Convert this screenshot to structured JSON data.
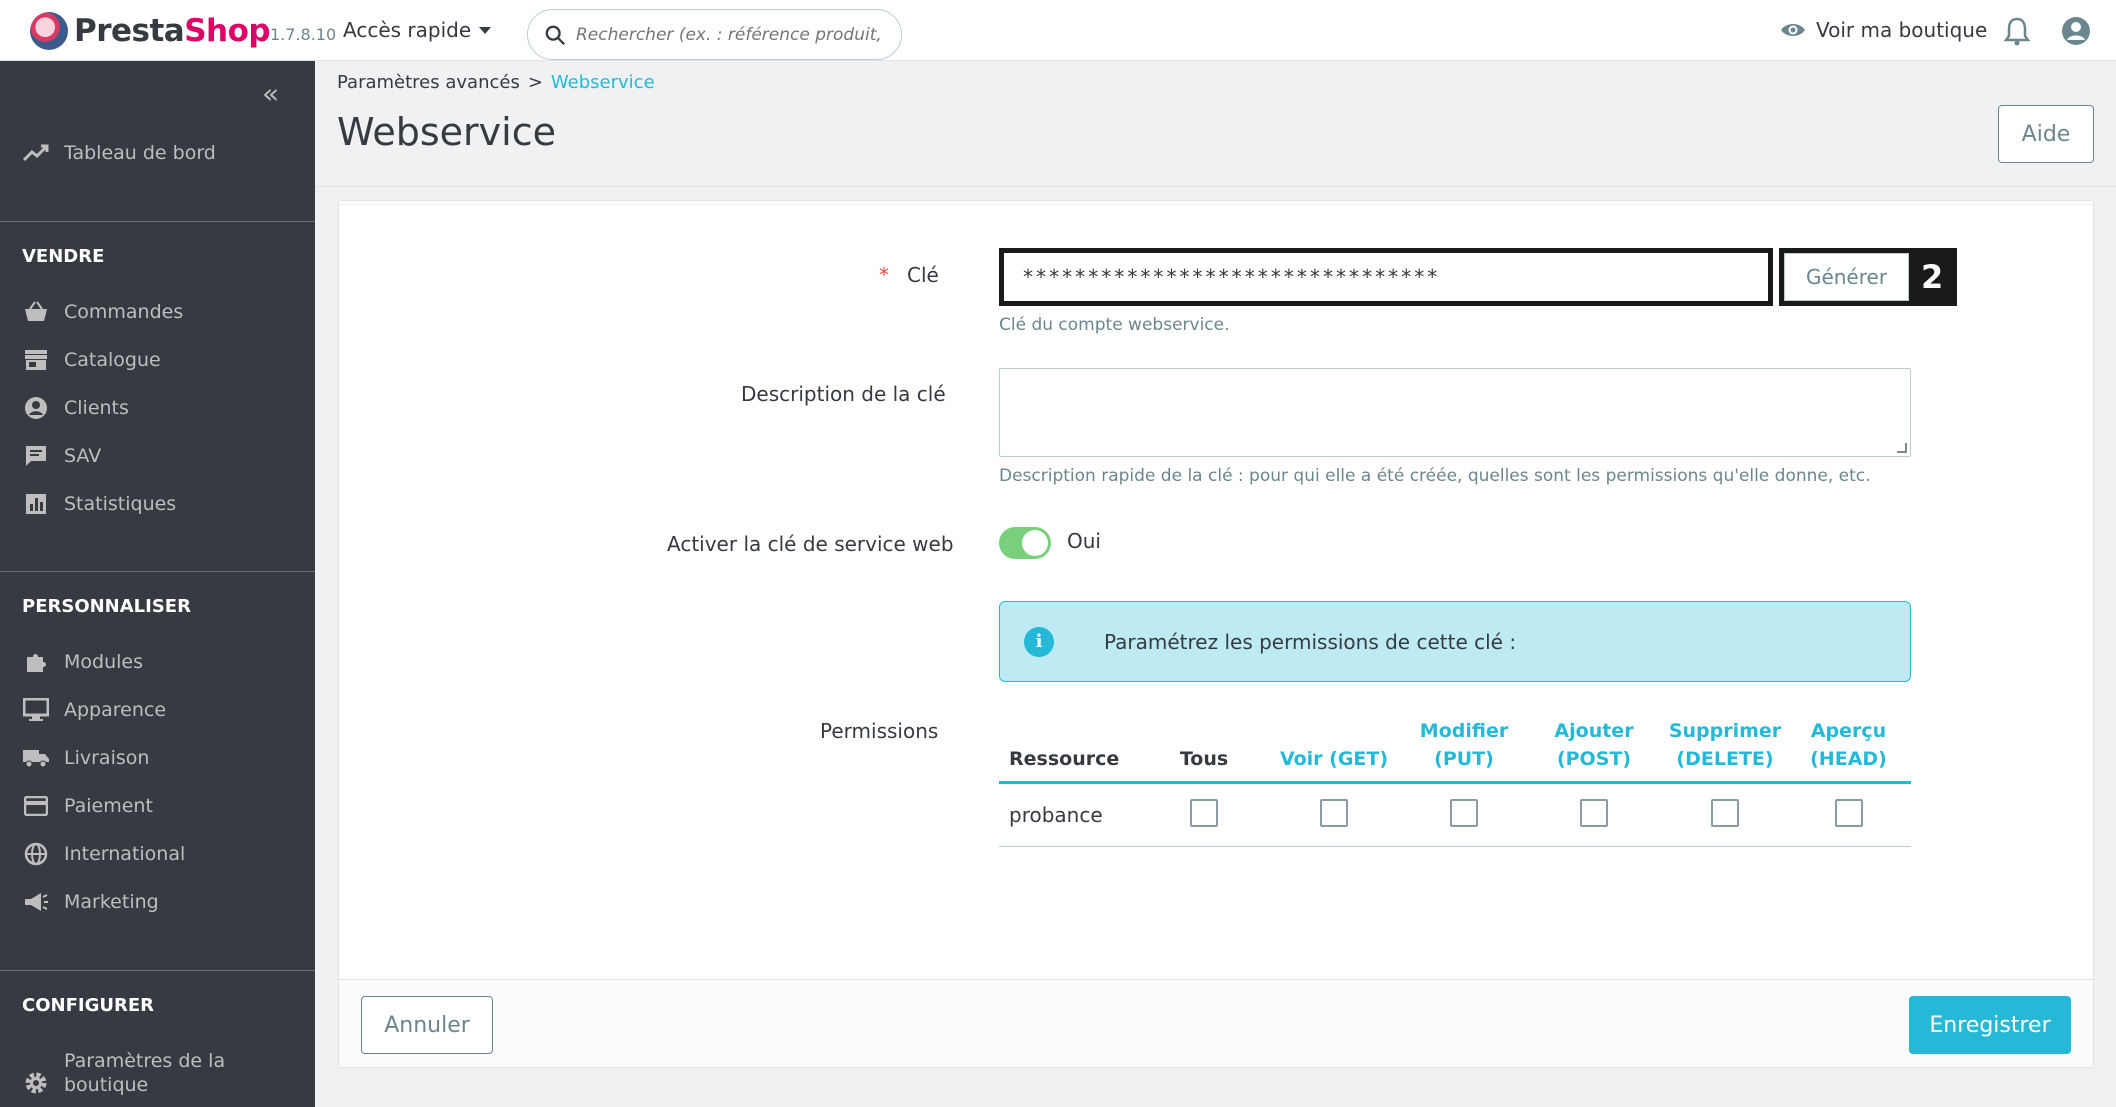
{
  "header": {
    "logo_text_1": "Presta",
    "logo_text_2": "Shop",
    "version": "1.7.8.10",
    "quick_access": "Accès rapide",
    "search_placeholder": "Rechercher (ex. : référence produit, no",
    "view_shop": "Voir ma boutique"
  },
  "sidebar": {
    "dashboard": "Tableau de bord",
    "sections": {
      "sell": "VENDRE",
      "customize": "PERSONNALISER",
      "configure": "CONFIGURER"
    },
    "sell_items": [
      "Commandes",
      "Catalogue",
      "Clients",
      "SAV",
      "Statistiques"
    ],
    "customize_items": [
      "Modules",
      "Apparence",
      "Livraison",
      "Paiement",
      "International",
      "Marketing"
    ],
    "configure_items": [
      "Paramètres de la",
      "boutique"
    ]
  },
  "breadcrumb": {
    "parent": "Paramètres avancés",
    "separator": ">",
    "current": "Webservice"
  },
  "page_title": "Webservice",
  "help_button": "Aide",
  "form": {
    "key_required": "*",
    "key_label": "Clé",
    "key_value": "********************************",
    "generate_button": "Générer",
    "step_marker": "2",
    "key_help": "Clé du compte webservice.",
    "description_label": "Description de la clé",
    "description_value": "",
    "description_help": "Description rapide de la clé : pour qui elle a été créée, quelles sont les permissions qu'elle donne, etc.",
    "enable_label": "Activer la clé de service web",
    "enable_value": "Oui",
    "alert_text": "Paramétrez les permissions de cette clé :",
    "permissions_label": "Permissions"
  },
  "permissions": {
    "headers": {
      "resource": "Ressource",
      "all": "Tous",
      "get": "Voir (GET)",
      "put_1": "Modifier",
      "put_2": "(PUT)",
      "post_1": "Ajouter",
      "post_2": "(POST)",
      "delete_1": "Supprimer",
      "delete_2": "(DELETE)",
      "head_1": "Aperçu",
      "head_2": "(HEAD)"
    },
    "rows": [
      {
        "resource": "probance",
        "all": false,
        "get": false,
        "put": false,
        "post": false,
        "delete": false,
        "head": false
      }
    ]
  },
  "footer": {
    "cancel": "Annuler",
    "save": "Enregistrer"
  },
  "colors": {
    "primary": "#25b9d7",
    "sidebar": "#363a41",
    "toggle_on": "#78d07d",
    "brand": "#df0067"
  }
}
